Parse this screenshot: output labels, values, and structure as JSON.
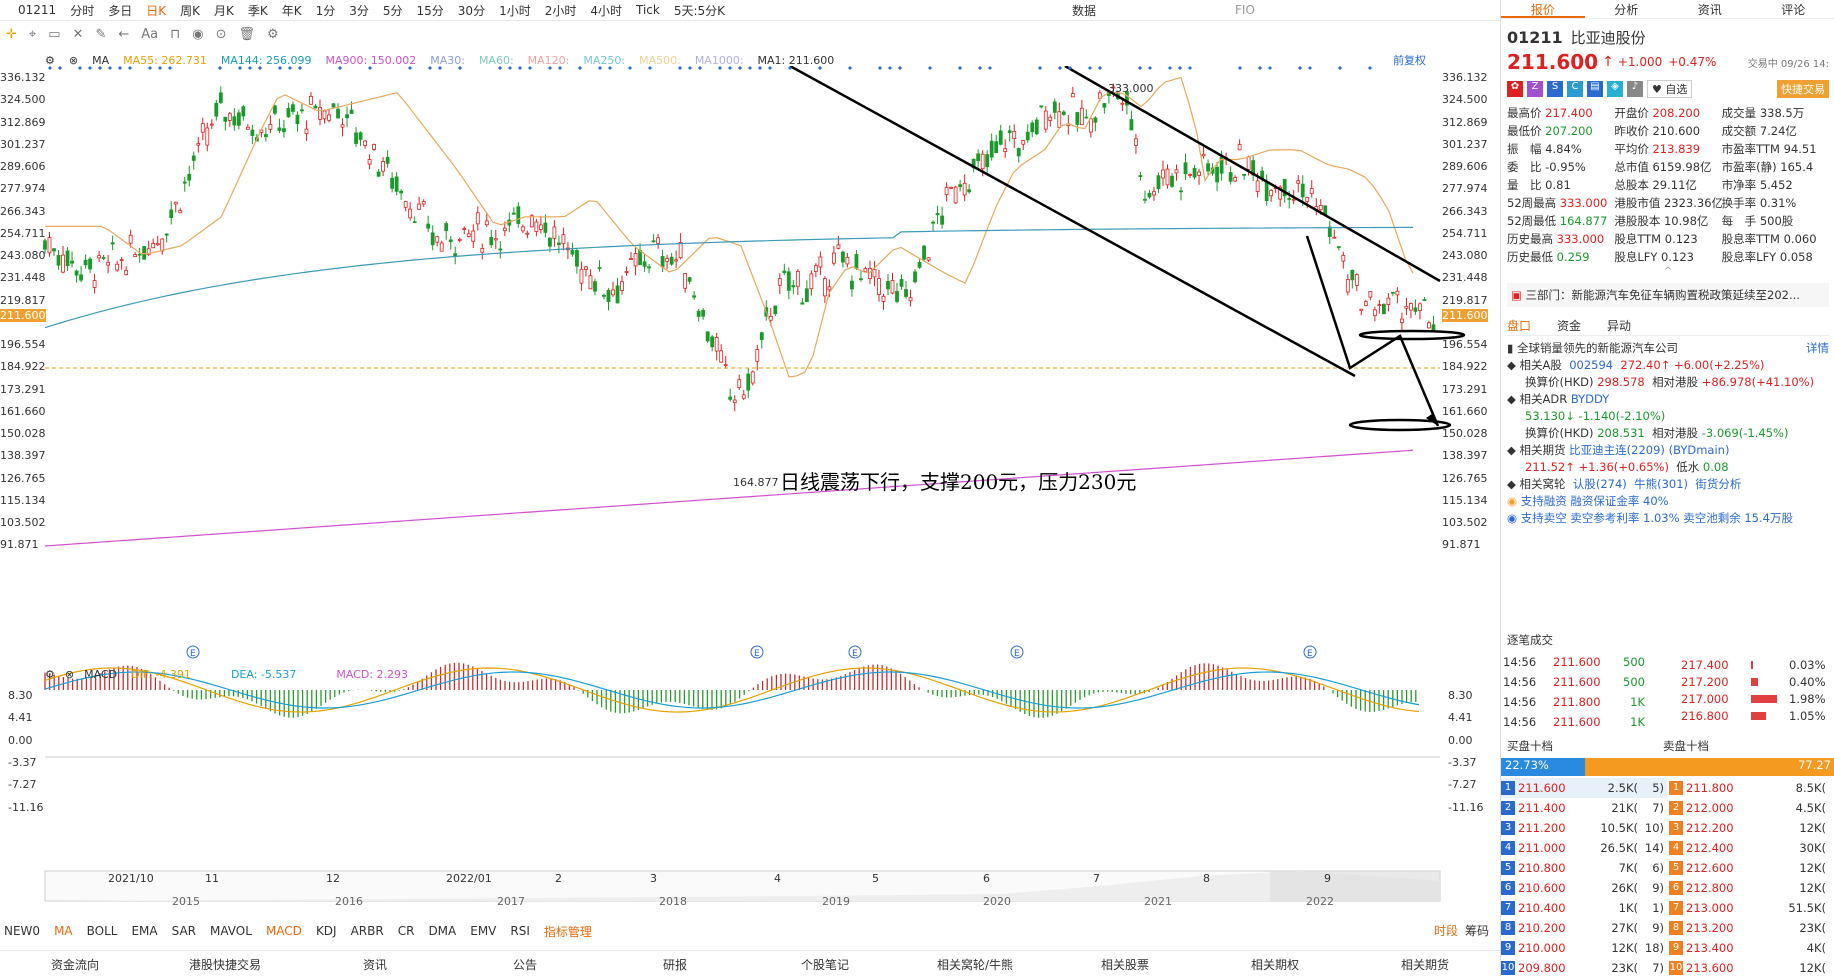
{
  "topbar": {
    "code": "01211",
    "periods": [
      "分时",
      "多日",
      "日K",
      "周K",
      "月K",
      "季K",
      "年K",
      "1分",
      "3分",
      "5分",
      "15分",
      "30分",
      "1小时",
      "2小时",
      "4小时",
      "Tick",
      "5天:5分K"
    ],
    "right": [
      "数据",
      "FIO"
    ]
  },
  "ma_legend": {
    "label": "MA",
    "ma55": "MA55: 262.731",
    "ma144": "MA144: 256.099",
    "ma900": "MA900: 150.002",
    "ma30": "MA30:",
    "ma60": "MA60:",
    "ma120": "MA120:",
    "ma250": "MA250:",
    "ma500": "MA500:",
    "ma1000": "MA1000:",
    "ma1": "MA1: 211.600",
    "fq": "前复权"
  },
  "y_ticks": [
    "336.132",
    "324.500",
    "312.869",
    "301.237",
    "289.606",
    "277.974",
    "266.343",
    "254.711",
    "243.080",
    "231.448",
    "219.817",
    "211.600",
    "196.554",
    "184.922",
    "173.291",
    "161.660",
    "150.028",
    "138.397",
    "126.765",
    "115.134",
    "103.502",
    "91.871"
  ],
  "annotations": {
    "high_label": "333.000",
    "low_label": "164.877",
    "note": "日线震荡下行，支撑200元，压力230元"
  },
  "macd_legend": {
    "label": "MACD",
    "dif": "DIF: -4.391",
    "dea": "DEA: -5.537",
    "macd": "MACD: 2.293"
  },
  "macd_ticks": [
    "8.30",
    "4.41",
    "0.00",
    "-3.37",
    "-7.27",
    "-11.16"
  ],
  "x_labels": [
    "2021/10",
    "11",
    "12",
    "2022/01",
    "2",
    "3",
    "4",
    "5",
    "6",
    "7",
    "8",
    "9"
  ],
  "overview_years": [
    "2015",
    "2016",
    "2017",
    "2018",
    "2019",
    "2020",
    "2021",
    "2022"
  ],
  "indicators": [
    "NEW0",
    "MA",
    "BOLL",
    "EMA",
    "SAR",
    "MAVOL",
    "MACD",
    "KDJ",
    "ARBR",
    "CR",
    "DMA",
    "EMV",
    "RSI",
    "指标管理"
  ],
  "indicator_right": [
    "时段",
    "筹码"
  ],
  "bottom_nav": [
    "资金流向",
    "港股快捷交易",
    "资讯",
    "公告",
    "研报",
    "个股笔记",
    "相关窝轮/牛熊",
    "相关股票",
    "相关期权",
    "相关期货"
  ],
  "panel": {
    "tabs": [
      "报价",
      "分析",
      "资讯",
      "评论"
    ],
    "code": "01211",
    "name": "比亚迪股份",
    "price": "211.600",
    "change": "+1.000",
    "pct": "+0.47%",
    "time": "交易中 09/26 14:",
    "watch": "自选",
    "fast_trade": "快捷交易",
    "quote": [
      [
        "最高价",
        "217.400",
        "开盘价",
        "208.200",
        "成交量",
        "338.5万"
      ],
      [
        "最低价",
        "207.200",
        "昨收价",
        "210.600",
        "成交额",
        "7.24亿"
      ],
      [
        "振　幅",
        "4.84%",
        "平均价",
        "213.839",
        "市盈率TTM",
        "94.51"
      ],
      [
        "委　比",
        "-0.95%",
        "总市值",
        "6159.98亿",
        "市盈率(静)",
        "165.4"
      ],
      [
        "量　比",
        "0.81",
        "总股本",
        "29.11亿",
        "市净率",
        "5.452"
      ],
      [
        "52周最高",
        "333.000",
        "港股市值",
        "2323.36亿",
        "换手率",
        "0.31%"
      ],
      [
        "52周最低",
        "164.877",
        "港股股本",
        "10.98亿",
        "每　手",
        "500股"
      ],
      [
        "历史最高",
        "333.000",
        "股息TTM",
        "0.123",
        "股息率TTM",
        "0.060"
      ],
      [
        "历史最低",
        "0.259",
        "股息LFY",
        "0.123",
        "股息率LFY",
        "0.058"
      ]
    ],
    "news": "三部门：新能源汽车免征车辆购置税政策延续至202...",
    "subtabs": [
      "盘口",
      "资金",
      "异动"
    ],
    "desc": "全球销量领先的新能源汽车公司",
    "detail": "详情",
    "a_share_label": "相关A股",
    "a_share_code": "002594",
    "a_share_price": "272.40",
    "a_share_chg": "+6.00(+2.25%)",
    "conv_label": "换算价(HKD)",
    "conv_price": "298.578",
    "rel_label": "相对港股",
    "rel_val": "+86.978(+41.10%)",
    "adr_label": "相关ADR",
    "adr_code": "BYDDY",
    "adr_price": "53.130",
    "adr_chg": "-1.140(-2.10%)",
    "adr_conv": "208.531",
    "adr_rel": "-3.069(-1.45%)",
    "fut_label": "相关期货",
    "fut_name": "比亚迪主连(2209)",
    "fut_code": "(BYDmain)",
    "fut_price": "211.52",
    "fut_chg": "+1.36(+0.65%)",
    "fut_low": "低水",
    "fut_low_val": "0.08",
    "warrant_label": "相关窝轮",
    "warrant_call": "认股(274)",
    "warrant_bull": "牛熊(301)",
    "warrant_analysis": "街货分析",
    "margin": "支持融资",
    "margin_rate": "融资保证金率 40%",
    "short": "支持卖空",
    "short_rate": "卖空参考利率 1.03%",
    "short_pool": "卖空池剩余 15.4万股",
    "ticks_title": "逐笔成交",
    "ticks": [
      [
        "14:56",
        "211.600",
        "500"
      ],
      [
        "14:56",
        "211.600",
        "500"
      ],
      [
        "14:56",
        "211.800",
        "1K"
      ],
      [
        "14:56",
        "211.600",
        "1K"
      ]
    ],
    "dist": [
      [
        "217.400",
        "0.03%"
      ],
      [
        "217.200",
        "0.40%"
      ],
      [
        "217.000",
        "1.98%"
      ],
      [
        "216.800",
        "1.05%"
      ]
    ],
    "bid_title": "买盘十档",
    "ask_title": "卖盘十档",
    "bid_pct": "22.73%",
    "ask_pct": "77.27",
    "bids": [
      [
        "1",
        "211.600",
        "2.5K",
        "5"
      ],
      [
        "2",
        "211.400",
        "21K",
        "7"
      ],
      [
        "3",
        "211.200",
        "10.5K",
        "10"
      ],
      [
        "4",
        "211.000",
        "26.5K",
        "14"
      ],
      [
        "5",
        "210.800",
        "7K",
        "6"
      ],
      [
        "6",
        "210.600",
        "26K",
        "9"
      ],
      [
        "7",
        "210.400",
        "1K",
        "1"
      ],
      [
        "8",
        "210.200",
        "27K",
        "9"
      ],
      [
        "9",
        "210.000",
        "12K",
        "18"
      ],
      [
        "10",
        "209.800",
        "23K",
        "7"
      ]
    ],
    "asks": [
      [
        "1",
        "211.800",
        "8.5K"
      ],
      [
        "2",
        "212.000",
        "4.5K"
      ],
      [
        "3",
        "212.200",
        "12K"
      ],
      [
        "4",
        "212.400",
        "30K"
      ],
      [
        "5",
        "212.600",
        "12K"
      ],
      [
        "6",
        "212.800",
        "12K"
      ],
      [
        "7",
        "213.000",
        "51.5K"
      ],
      [
        "8",
        "213.200",
        "23K"
      ],
      [
        "9",
        "213.400",
        "4K"
      ],
      [
        "10",
        "213.600",
        "12K"
      ]
    ]
  }
}
